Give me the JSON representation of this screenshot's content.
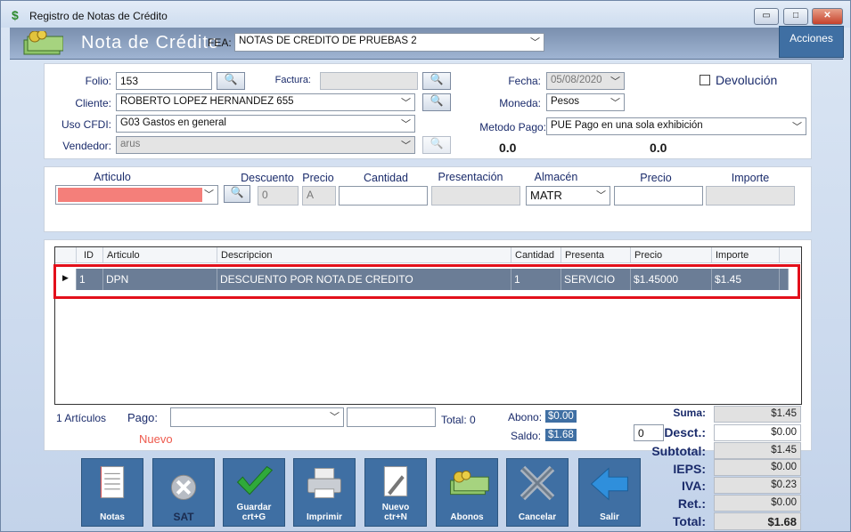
{
  "window": {
    "title": "Registro de Notas de Crédito",
    "minimize": "▭",
    "maximize": "□",
    "close": "✕"
  },
  "banner": {
    "title": "Nota de Crédito",
    "series_label": "FEA:",
    "series_value": "NOTAS DE CREDITO DE PRUEBAS 2",
    "acciones": "Acciones"
  },
  "form": {
    "folio_label": "Folio:",
    "folio_value": "153",
    "factura_label": "Factura:",
    "factura_value": "",
    "fecha_label": "Fecha:",
    "fecha_value": "05/08/2020",
    "devolucion_label": "Devolución",
    "cliente_label": "Cliente:",
    "cliente_value": "ROBERTO LOPEZ HERNANDEZ 655",
    "moneda_label": "Moneda:",
    "moneda_value": "Pesos",
    "uso_label": "Uso CFDI:",
    "uso_value": "G03 Gastos en general",
    "metodo_label": "Metodo Pago:",
    "metodo_value": "PUE Pago en una sola exhibición",
    "vendedor_label": "Vendedor:",
    "vendedor_value": "arus",
    "amount_left": "0.0",
    "amount_right": "0.0"
  },
  "item_entry": {
    "headers": {
      "articulo": "Articulo",
      "descuento": "Descuento",
      "precio": "Precio",
      "cantidad": "Cantidad",
      "presentacion": "Presentación",
      "almacen": "Almacén",
      "precio2": "Precio",
      "importe": "Importe"
    },
    "descuento_value": "0",
    "precio_value": "A",
    "almacen_value": "MATR",
    "articulo_highlight": "#f47f7a"
  },
  "grid": {
    "columns": [
      "ID",
      "Articulo",
      "Descripcion",
      "Cantidad",
      "Presenta",
      "Precio",
      "Importe"
    ],
    "rows": [
      {
        "id": "1",
        "articulo": "DPN",
        "descripcion": "DESCUENTO POR NOTA DE CREDITO",
        "cantidad": "1",
        "presenta": "SERVICIO",
        "precio": "$1.45000",
        "importe": "$1.45"
      }
    ],
    "selected_color": "#6b7d96",
    "highlight_color": "#e3101b"
  },
  "footer": {
    "articulos": "1 Artículos",
    "pago_label": "Pago:",
    "total_label": "Total: 0",
    "abono_label": "Abono:",
    "abono_value": "$0.00",
    "saldo_label": "Saldo:",
    "saldo_value": "$1.68",
    "nuevo": "Nuevo",
    "desc_qty": "0"
  },
  "totals": [
    {
      "label": "Suma:",
      "value": "$1.45"
    },
    {
      "label": "Desct.:",
      "value": "$0.00"
    },
    {
      "label": "Subtotal:",
      "value": "$1.45"
    },
    {
      "label": "IEPS:",
      "value": "$0.00"
    },
    {
      "label": "IVA:",
      "value": "$0.23"
    },
    {
      "label": "Ret.:",
      "value": "$0.00"
    },
    {
      "label": "Total:",
      "value": "$1.68"
    }
  ],
  "toolbar": {
    "notas": "Notas",
    "sat": "SAT",
    "guardar": "Guardar",
    "guardar_sc": "crt+G",
    "imprimir": "Imprimir",
    "nuevo": "Nuevo",
    "nuevo_sc": "ctr+N",
    "abonos": "Abonos",
    "cancelar": "Cancelar",
    "salir": "Salir"
  }
}
